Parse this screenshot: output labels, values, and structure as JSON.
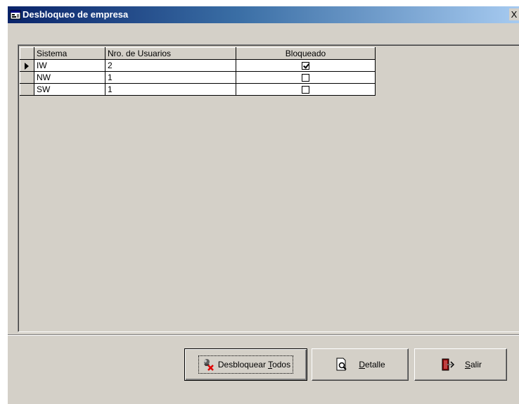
{
  "window": {
    "title": "Desbloqueo de empresa",
    "close_label": "X"
  },
  "grid": {
    "columns": [
      "Sistema",
      "Nro. de Usuarios",
      "Bloqueado"
    ],
    "rows": [
      {
        "sistema": "IW",
        "usuarios": "2",
        "bloqueado": true,
        "current": true
      },
      {
        "sistema": "NW",
        "usuarios": "1",
        "bloqueado": false,
        "current": false
      },
      {
        "sistema": "SW",
        "usuarios": "1",
        "bloqueado": false,
        "current": false
      }
    ]
  },
  "buttons": {
    "desbloquear_pre": "Desbloquear ",
    "desbloquear_ul": "T",
    "desbloquear_post": "odos",
    "detalle_ul": "D",
    "detalle_post": "etalle",
    "salir_ul": "S",
    "salir_post": "alir"
  },
  "icons": {
    "app": "window-icon",
    "desbloquear": "unlock-x-icon",
    "detalle": "magnify-doc-icon",
    "salir": "exit-door-icon"
  }
}
